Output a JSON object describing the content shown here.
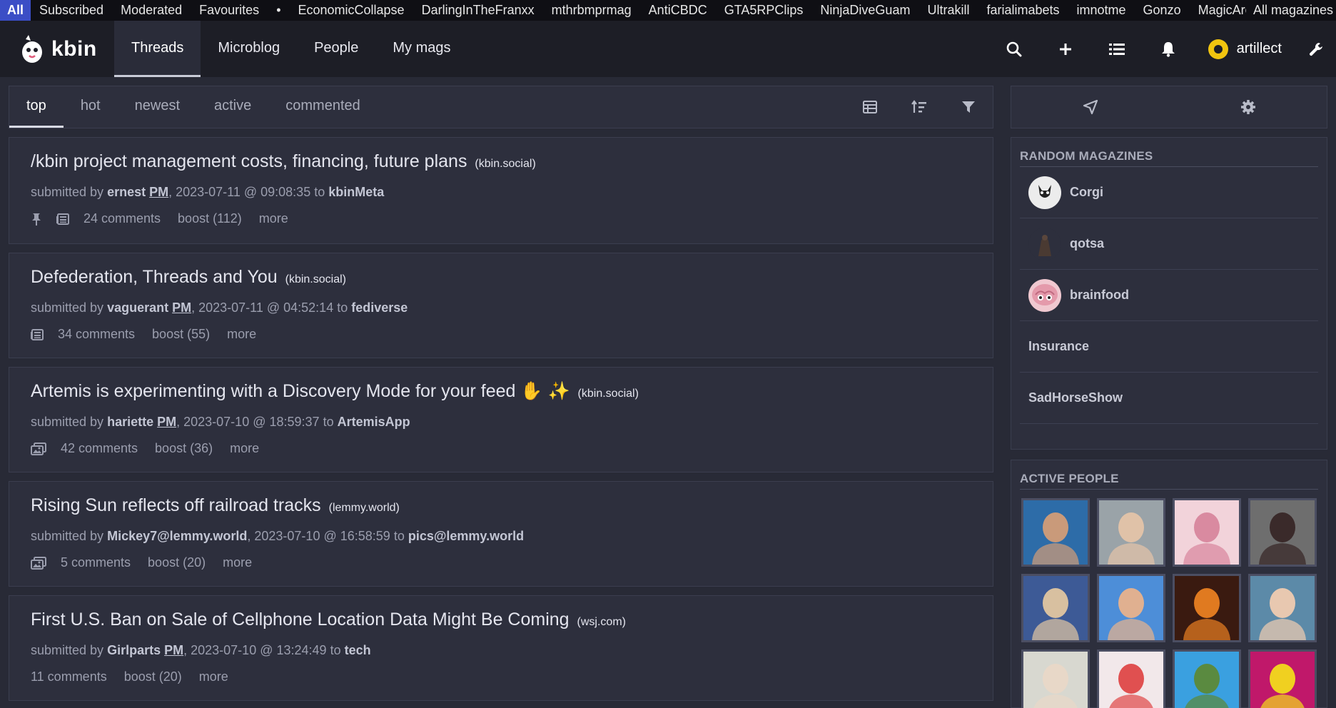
{
  "topbar": {
    "active": "All",
    "items": [
      "Subscribed",
      "Moderated",
      "Favourites"
    ],
    "separator": "•",
    "magazines": [
      "EconomicCollapse",
      "DarlingInTheFranxx",
      "mthrbmprmag",
      "AntiCBDC",
      "GTA5RPClips",
      "NinjaDiveGuam",
      "Ultrakill",
      "farialimabets",
      "imnotme",
      "Gonzo",
      "MagicArena"
    ],
    "all_magazines": "All magazines"
  },
  "header": {
    "brand": "kbin",
    "nav": [
      "Threads",
      "Microblog",
      "People",
      "My mags"
    ],
    "active_nav": "Threads",
    "username": "artillect",
    "icons": [
      "search-icon",
      "plus-icon",
      "list-icon",
      "bell-icon",
      "wrench-icon"
    ]
  },
  "options": {
    "sort": [
      "top",
      "hot",
      "newest",
      "active",
      "commented"
    ],
    "active_sort": "top",
    "icons": [
      "layout-icon",
      "sort-icon",
      "filter-icon"
    ]
  },
  "entries": [
    {
      "title": "/kbin project management costs, financing, future plans",
      "domain": "(kbin.social)",
      "submitted_by_label": "submitted by",
      "author": "ernest",
      "pm": "PM",
      "date": ", 2023-07-11 @ 09:08:35",
      "to_label": "to",
      "magazine": "kbinMeta",
      "pinned": true,
      "icon": "article-icon",
      "comments": "24 comments",
      "boost": "boost (112)",
      "more": "more"
    },
    {
      "title": "Defederation, Threads and You",
      "domain": "(kbin.social)",
      "submitted_by_label": "submitted by",
      "author": "vaguerant",
      "pm": "PM",
      "date": ", 2023-07-11 @ 04:52:14",
      "to_label": "to",
      "magazine": "fediverse",
      "pinned": false,
      "icon": "article-icon",
      "comments": "34 comments",
      "boost": "boost (55)",
      "more": "more"
    },
    {
      "title": "Artemis is experimenting with a Discovery Mode for your feed ✋ ✨",
      "domain": "(kbin.social)",
      "submitted_by_label": "submitted by",
      "author": "hariette",
      "pm": "PM",
      "date": ", 2023-07-10 @ 18:59:37",
      "to_label": "to",
      "magazine": "ArtemisApp",
      "pinned": false,
      "icon": "images-icon",
      "comments": "42 comments",
      "boost": "boost (36)",
      "more": "more"
    },
    {
      "title": "Rising Sun reflects off railroad tracks",
      "domain": "(lemmy.world)",
      "submitted_by_label": "submitted by",
      "author": "Mickey7@lemmy.world",
      "pm": "",
      "date": ", 2023-07-10 @ 16:58:59",
      "to_label": "to",
      "magazine": "pics@lemmy.world",
      "pinned": false,
      "icon": "images-icon",
      "comments": "5 comments",
      "boost": "boost (20)",
      "more": "more"
    },
    {
      "title": "First U.S. Ban on Sale of Cellphone Location Data Might Be Coming",
      "domain": "(wsj.com)",
      "submitted_by_label": "submitted by",
      "author": "Girlparts",
      "pm": "PM",
      "date": ", 2023-07-10 @ 13:24:49",
      "to_label": "to",
      "magazine": "tech",
      "pinned": false,
      "icon": "",
      "comments": "11 comments",
      "boost": "boost (20)",
      "more": "more"
    }
  ],
  "sidebar": {
    "top_icons": [
      "federation-icon",
      "settings-gear-icon"
    ],
    "random_magazines": {
      "heading": "RANDOM MAGAZINES",
      "items": [
        {
          "name": "Corgi",
          "avatar": true,
          "color": "#e8e8e8"
        },
        {
          "name": "qotsa",
          "avatar": true,
          "color": "#3a302c"
        },
        {
          "name": "brainfood",
          "avatar": true,
          "color": "#e6a3b0"
        },
        {
          "name": "Insurance",
          "avatar": false
        },
        {
          "name": "SadHorseShow",
          "avatar": false
        }
      ]
    },
    "active_people": {
      "heading": "ACTIVE PEOPLE",
      "avatars": [
        {
          "bg": "#2d6ca8",
          "fg": "#c99a7a"
        },
        {
          "bg": "#9aa3a8",
          "fg": "#e0c2a8"
        },
        {
          "bg": "#f2d3da",
          "fg": "#d98aa0"
        },
        {
          "bg": "#6e6e6e",
          "fg": "#3a2a2a"
        },
        {
          "bg": "#3d5a96",
          "fg": "#d8c0a0"
        },
        {
          "bg": "#4d8ed8",
          "fg": "#e0b090"
        },
        {
          "bg": "#3a1a10",
          "fg": "#e07a20"
        },
        {
          "bg": "#5c8aa8",
          "fg": "#e8c8b0"
        },
        {
          "bg": "#d8d8d0",
          "fg": "#e8d8c8"
        },
        {
          "bg": "#f2e8ea",
          "fg": "#e05050"
        },
        {
          "bg": "#3aa0e0",
          "fg": "#5a8a40"
        },
        {
          "bg": "#c0186a",
          "fg": "#f0d020"
        }
      ]
    }
  },
  "colors": {
    "accent": "#3b4ec6",
    "background": "#282a36",
    "panel": "#2d2f3d",
    "header": "#1d1e26"
  }
}
